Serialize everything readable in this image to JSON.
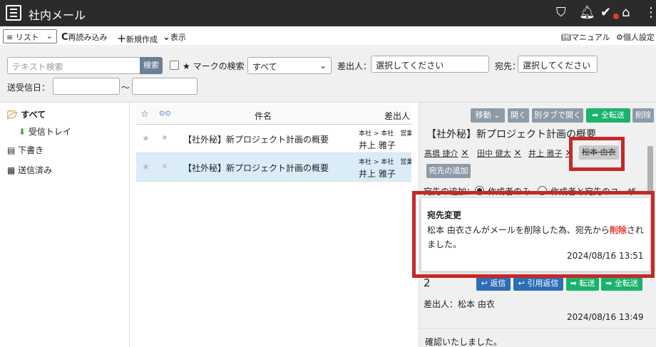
{
  "app": {
    "title": "社内メール"
  },
  "toolbar": {
    "list_view": "リスト",
    "reload": "再読み込み",
    "new_mail": "新規作成",
    "display": "表示",
    "manual": "マニュアル",
    "personal_settings": "個人設定"
  },
  "search": {
    "text_placeholder": "テキスト検索",
    "search_button": "検索",
    "mark_search_label": "★ マークの検索",
    "mark_select_value": "すべて",
    "sender_label": "差出人：",
    "sender_value": "選択してください",
    "recipient_label": "宛先：",
    "recipient_value": "選択してください",
    "date_label": "送受信日：",
    "date_sep": "〜"
  },
  "folders": [
    {
      "label": "すべて"
    },
    {
      "label": "受信トレイ"
    },
    {
      "label": "下書き"
    },
    {
      "label": "送信済み"
    }
  ],
  "mail_list": {
    "headers": {
      "star": "☆",
      "read": "⊙⊙",
      "subject": "件名",
      "sender": "差出人"
    },
    "rows": [
      {
        "subject": "【社外秘】新プロジェクト計画の概要",
        "path": "本社 > 本社　営業",
        "sender": "井上 雅子",
        "selected": false
      },
      {
        "subject": "【社外秘】新プロジェクト計画の概要",
        "path": "本社 > 本社　営業",
        "sender": "井上 雅子",
        "selected": true
      }
    ]
  },
  "detail": {
    "buttons": {
      "move": "移動",
      "open": "開く",
      "open_new_tab": "別タブで開く",
      "forward_all": "全転送",
      "delete": "削除"
    },
    "subject": "【社外秘】新プロジェクト計画の概要",
    "recipients": [
      {
        "name": "髙橋 捷介",
        "removed": false
      },
      {
        "name": "田中 健太",
        "removed": false
      },
      {
        "name": "井上 雅子",
        "removed": false
      },
      {
        "name": "松本 由衣",
        "removed": true
      }
    ],
    "add_recipient_button": "宛先の追加",
    "add_recipient_label": "宛先の追加：",
    "radio_creator_only": "作成者のみ",
    "radio_creator_and_recipients": "作成者と宛先のユーザ",
    "notice": {
      "title": "宛先変更",
      "body_prefix": "松本 由衣さんがメールを削除した為、宛先から",
      "body_highlight": "削除",
      "body_suffix": "され",
      "body_line2": "ました。",
      "timestamp": "2024/08/16 13:51"
    },
    "reply": {
      "number": "2",
      "reply": "返信",
      "quote_reply": "引用返信",
      "forward": "転送",
      "forward_all": "全転送"
    },
    "from_label": "差出人：松本 由衣",
    "sent_time": "2024/08/16 13:49",
    "body": "確認いたしました。"
  },
  "colors": {
    "title_bar": "#2b2b2b",
    "green": "#19b36b",
    "gray_button": "#8d9aa8",
    "blue_button": "#2d6eb5",
    "highlight_red": "#c62828"
  }
}
